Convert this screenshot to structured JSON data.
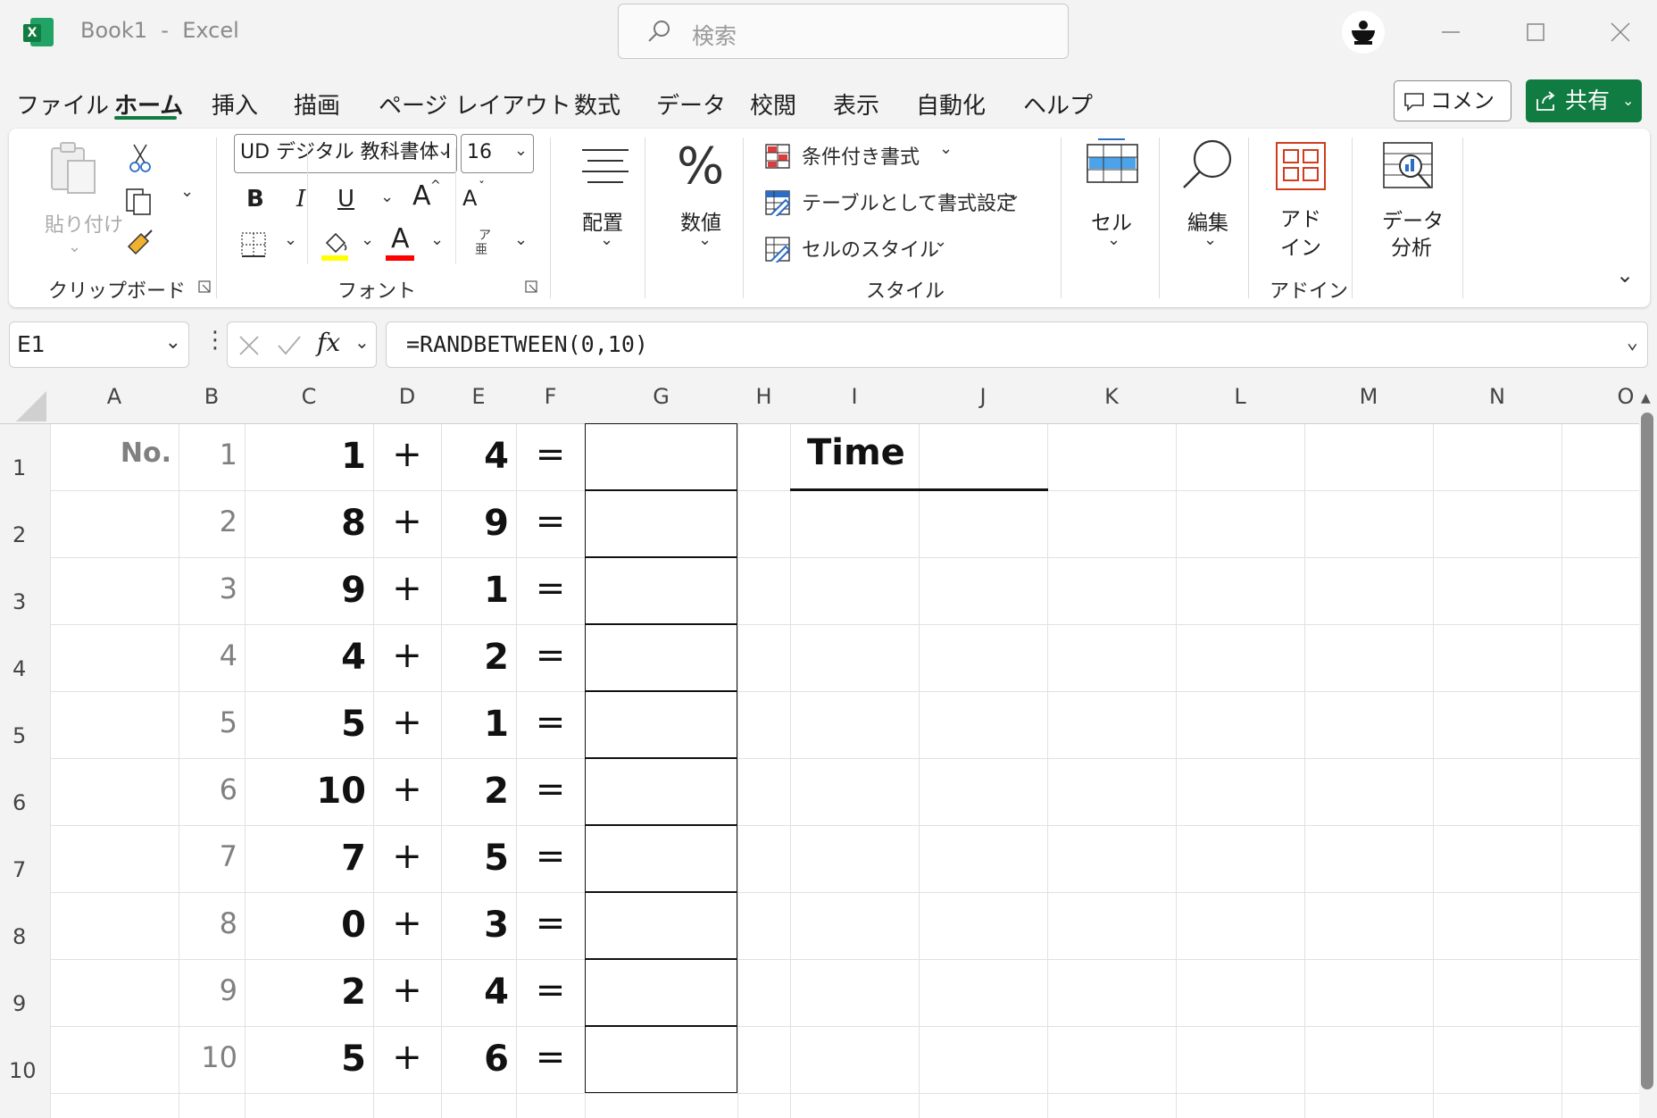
{
  "titlebar": {
    "book_name": "Book1",
    "separator": "-",
    "app_name": "Excel",
    "search_placeholder": "検索"
  },
  "menu": {
    "tabs": [
      "ファイル",
      "ホーム",
      "挿入",
      "描画",
      "ページ レイアウト",
      "数式",
      "データ",
      "校閲",
      "表示",
      "自動化",
      "ヘルプ"
    ],
    "active_tab": "ホーム",
    "comment_label": "コメント",
    "share_label": "共有"
  },
  "ribbon": {
    "clipboard": {
      "paste_label": "貼り付け",
      "group_label": "クリップボード"
    },
    "font": {
      "font_name": "UD デジタル 教科書体 I",
      "font_size": "16",
      "bold": "B",
      "italic": "I",
      "underline": "U",
      "grow": "A",
      "shrink": "A",
      "phonetic_top": "ア",
      "phonetic_bottom": "亜",
      "font_color_letter": "A",
      "group_label": "フォント",
      "highlight_color": "#ffff00",
      "font_color": "#ff0000"
    },
    "alignment": {
      "label": "配置"
    },
    "number": {
      "label": "数値",
      "symbol": "%"
    },
    "styles": {
      "conditional": "条件付き書式",
      "as_table": "テーブルとして書式設定",
      "cell_styles": "セルのスタイル",
      "group_label": "スタイル"
    },
    "cells": {
      "label": "セル"
    },
    "editing": {
      "label": "編集"
    },
    "addins": {
      "label_line1": "アド",
      "label_line2": "イン",
      "group_label": "アドイン"
    },
    "analysis": {
      "label_line1": "データ",
      "label_line2": "分析"
    }
  },
  "formula_bar": {
    "name_box": "E1",
    "fx": "fx",
    "formula": "=RANDBETWEEN(0,10)"
  },
  "sheet": {
    "columns": [
      "A",
      "B",
      "C",
      "D",
      "E",
      "F",
      "G",
      "H",
      "I",
      "J",
      "K",
      "L",
      "M",
      "N",
      "O"
    ],
    "rows": [
      "1",
      "2",
      "3",
      "4",
      "5",
      "6",
      "7",
      "8",
      "9",
      "10"
    ],
    "no_label": "No.",
    "time_label": "Time",
    "plus": "+",
    "equals": "=",
    "problems": [
      {
        "idx": "1",
        "a": "1",
        "b": "4"
      },
      {
        "idx": "2",
        "a": "8",
        "b": "9"
      },
      {
        "idx": "3",
        "a": "9",
        "b": "1"
      },
      {
        "idx": "4",
        "a": "4",
        "b": "2"
      },
      {
        "idx": "5",
        "a": "5",
        "b": "1"
      },
      {
        "idx": "6",
        "a": "10",
        "b": "2"
      },
      {
        "idx": "7",
        "a": "7",
        "b": "5"
      },
      {
        "idx": "8",
        "a": "0",
        "b": "3"
      },
      {
        "idx": "9",
        "a": "2",
        "b": "4"
      },
      {
        "idx": "10",
        "a": "5",
        "b": "6"
      }
    ]
  },
  "colors": {
    "excel_green": "#107c41"
  }
}
